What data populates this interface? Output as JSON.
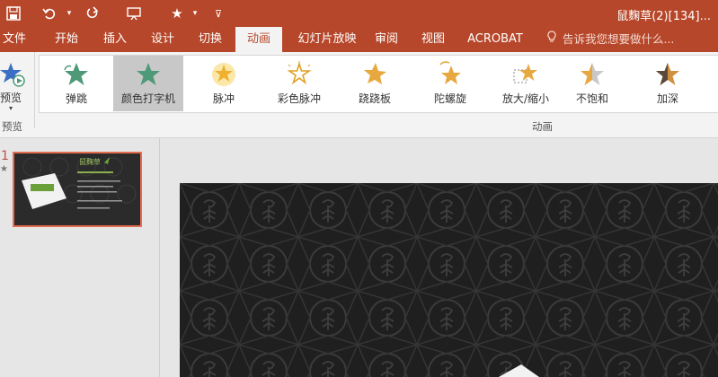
{
  "titlebar": {
    "doc_title": "鼠麴草(2)[134]...",
    "bg": "#b7472a"
  },
  "quick_access": [
    "save-icon",
    "undo-icon",
    "redo-icon",
    "start-from-beginning-icon",
    "customize-icon"
  ],
  "tabs": [
    "文件",
    "开始",
    "插入",
    "设计",
    "切换",
    "动画",
    "幻灯片放映",
    "审阅",
    "视图",
    "ACROBAT"
  ],
  "active_tab": "动画",
  "tell_me": "告诉我您想要做什么...",
  "ribbon": {
    "preview_label": "预览",
    "preview_group_label": "预览",
    "animation_group_label": "动画",
    "animations": [
      {
        "label": "弹跳",
        "color": "#4e9a78"
      },
      {
        "label": "颜色打字机",
        "color": "#4e9a78",
        "selected": true
      },
      {
        "label": "脉冲",
        "color": "#f0c040"
      },
      {
        "label": "彩色脉冲",
        "color": "#f0c040"
      },
      {
        "label": "跷跷板",
        "color": "#e8a840"
      },
      {
        "label": "陀螺旋",
        "color": "#e8a840"
      },
      {
        "label": "放大/缩小",
        "color": "#e8a840"
      },
      {
        "label": "不饱和",
        "color": "#e8a840"
      },
      {
        "label": "加深",
        "color": "#d09040"
      }
    ]
  },
  "slides": {
    "number": "1",
    "marker": "★",
    "thumb_title": "鼠麴草"
  },
  "colors": {
    "accent": "#b7472a",
    "selection": "#e46c4f"
  }
}
